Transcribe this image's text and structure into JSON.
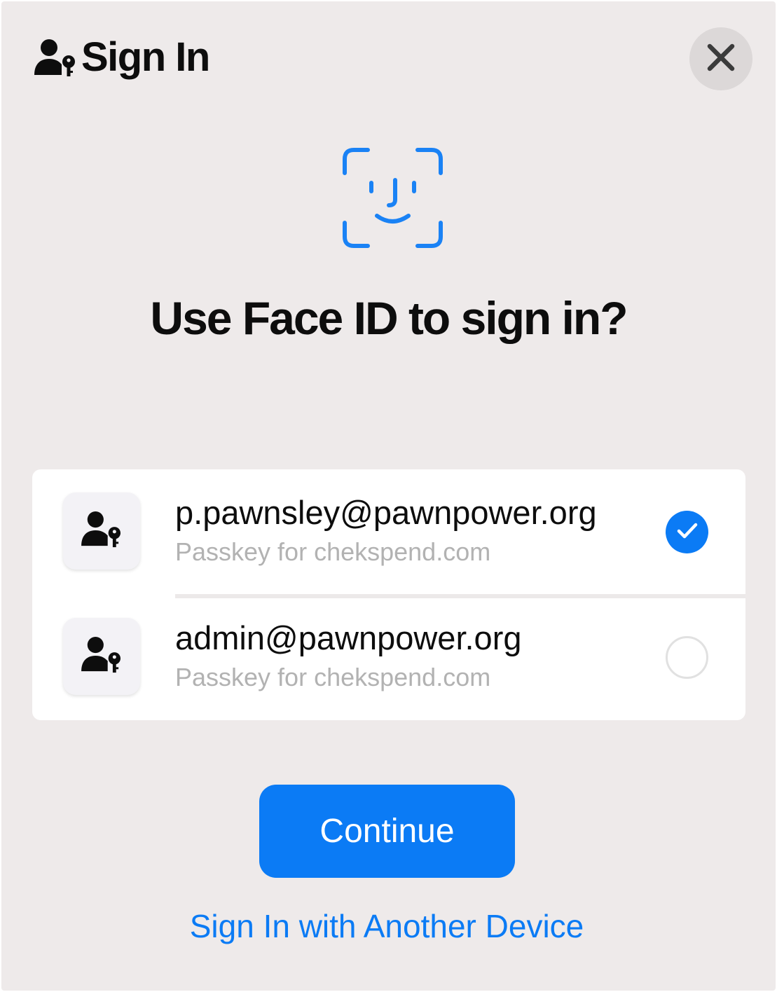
{
  "header": {
    "icon": "person-key-icon",
    "title": "Sign In",
    "close_icon": "close-icon"
  },
  "prompt": {
    "icon": "face-id-icon",
    "title": "Use Face ID to sign in?"
  },
  "accounts": [
    {
      "icon": "person-key-icon",
      "email": "p.pawnsley@pawnpower.org",
      "subtitle": "Passkey for chekspend.com",
      "selected": true
    },
    {
      "icon": "person-key-icon",
      "email": "admin@pawnpower.org",
      "subtitle": "Passkey for chekspend.com",
      "selected": false
    }
  ],
  "actions": {
    "continue_label": "Continue",
    "another_device_label": "Sign In with Another Device"
  },
  "colors": {
    "accent": "#0b7bf5",
    "background": "#eeeaea",
    "card": "#ffffff",
    "secondary_text": "#b2b2b2"
  }
}
